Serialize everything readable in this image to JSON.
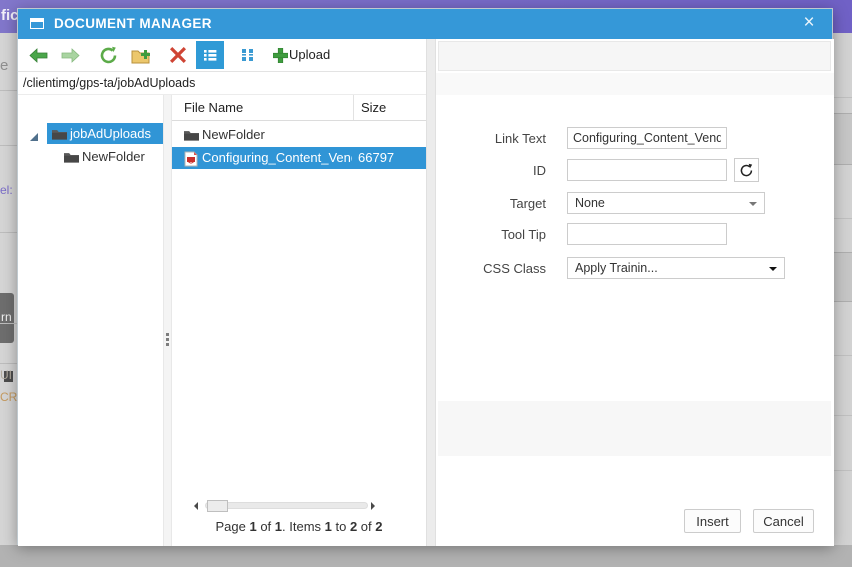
{
  "backdrop": {
    "header_fragment": "fic",
    "left_fragments": {
      "f1": "e",
      "f2": "el:",
      "f3": "rn",
      "f4": "UI",
      "f5": "CRI"
    }
  },
  "dialog": {
    "title": "DOCUMENT MANAGER",
    "close_glyph": "×",
    "toolbar": {
      "upload_label": "Upload"
    },
    "path": "/clientimg/gps-ta/jobAdUploads",
    "tree": {
      "items": [
        {
          "label": "jobAdUploads",
          "selected": true
        },
        {
          "label": "NewFolder",
          "selected": false
        }
      ]
    },
    "file_list": {
      "columns": {
        "name": "File Name",
        "size": "Size"
      },
      "rows": [
        {
          "name": "NewFolder",
          "size": "",
          "type": "folder",
          "selected": false
        },
        {
          "name": "Configuring_Content_Vendo",
          "size": "66797",
          "type": "pdf",
          "selected": true
        }
      ],
      "pager": {
        "segments": [
          {
            "t": "Page "
          },
          {
            "t": "1"
          },
          {
            "t": " of "
          },
          {
            "t": "1"
          },
          {
            "t": ". Items "
          },
          {
            "t": "1"
          },
          {
            "t": " to "
          },
          {
            "t": "2"
          },
          {
            "t": " of "
          },
          {
            "t": "2"
          }
        ]
      }
    },
    "form": {
      "fields": [
        {
          "label": "Link Text",
          "value": "Configuring_Content_Vendor",
          "type": "text"
        },
        {
          "label": "ID",
          "value": "",
          "type": "text"
        },
        {
          "label": "Target",
          "value": "None",
          "type": "select"
        },
        {
          "label": "Tool Tip",
          "value": "",
          "type": "text"
        },
        {
          "label": "CSS Class",
          "value": "Apply Trainin...",
          "type": "select"
        }
      ]
    },
    "footer": {
      "insert": "Insert",
      "cancel": "Cancel"
    }
  },
  "colors": {
    "titlebar": "#3598d8",
    "selection": "#3095d6",
    "toolbar_active": "#2f9ad6",
    "backdrop_header": "#7a6ec9"
  }
}
